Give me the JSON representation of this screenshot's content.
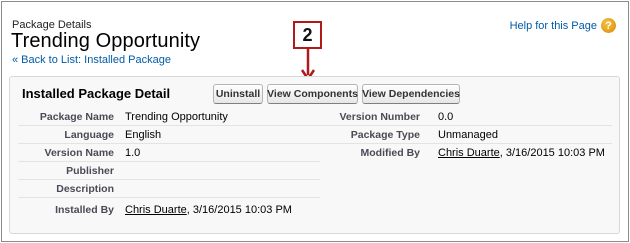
{
  "header": {
    "subtitle": "Package Details",
    "title": "Trending Opportunity",
    "back_link": "« Back to List: Installed Package",
    "help_link": "Help for this Page",
    "help_icon": "?"
  },
  "callout": {
    "number": "2",
    "color": "#b01a1a"
  },
  "panel": {
    "title": "Installed Package Detail",
    "buttons": {
      "uninstall": "Uninstall",
      "view_components": "View Components",
      "view_dependencies": "View Dependencies"
    },
    "left_fields": [
      {
        "label": "Package Name",
        "value": "Trending Opportunity"
      },
      {
        "label": "Language",
        "value": "English"
      },
      {
        "label": "Version Name",
        "value": "1.0"
      },
      {
        "label": "Publisher",
        "value": ""
      },
      {
        "label": "Description",
        "value": ""
      },
      {
        "label": "Installed By",
        "value_link": "Chris Duarte",
        "value_rest": ", 3/16/2015 10:03 PM"
      }
    ],
    "right_fields": [
      {
        "label": "Version Number",
        "value": "0.0"
      },
      {
        "label": "Package Type",
        "value": "Unmanaged"
      },
      {
        "label": "Modified By",
        "value_link": "Chris Duarte",
        "value_rest": ", 3/16/2015 10:03 PM"
      }
    ]
  },
  "colors": {
    "link": "#015ba7",
    "label": "#4a4a56",
    "panel_bg": "#f8f8f8"
  }
}
